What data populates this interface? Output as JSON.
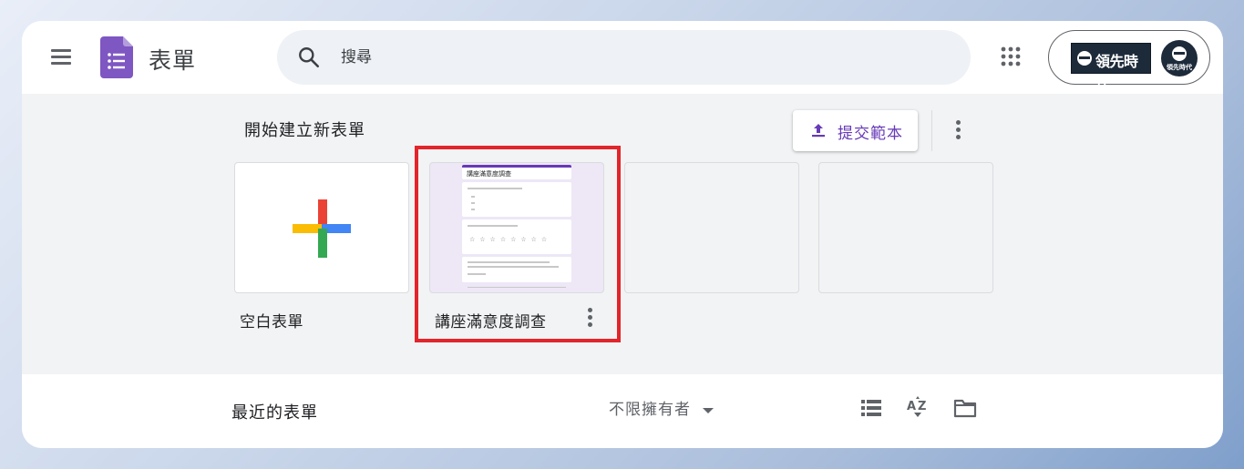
{
  "header": {
    "app_title": "表單",
    "search_placeholder": "搜尋",
    "account": {
      "brand_name": "領先時代",
      "avatar_text": "領先時代"
    }
  },
  "gallery": {
    "title": "開始建立新表單",
    "submit_template_label": "提交範本",
    "cards": [
      {
        "label": "空白表單"
      },
      {
        "label": "講座滿意度調查",
        "preview_title": "講座滿意度調查"
      },
      {
        "label": ""
      },
      {
        "label": ""
      }
    ]
  },
  "recent": {
    "title": "最近的表單",
    "owner_filter": "不限擁有者"
  },
  "colors": {
    "forms_purple": "#673ab7",
    "highlight_red": "#e3242b",
    "plus_red": "#ea4335",
    "plus_blue": "#4285f4",
    "plus_yellow": "#fbbc04",
    "plus_green": "#34a853"
  },
  "icons": [
    "menu-icon",
    "forms-logo-icon",
    "search-icon",
    "apps-grid-icon",
    "upload-icon",
    "more-vert-icon",
    "plus-icon",
    "list-view-icon",
    "sort-az-icon",
    "folder-icon"
  ]
}
